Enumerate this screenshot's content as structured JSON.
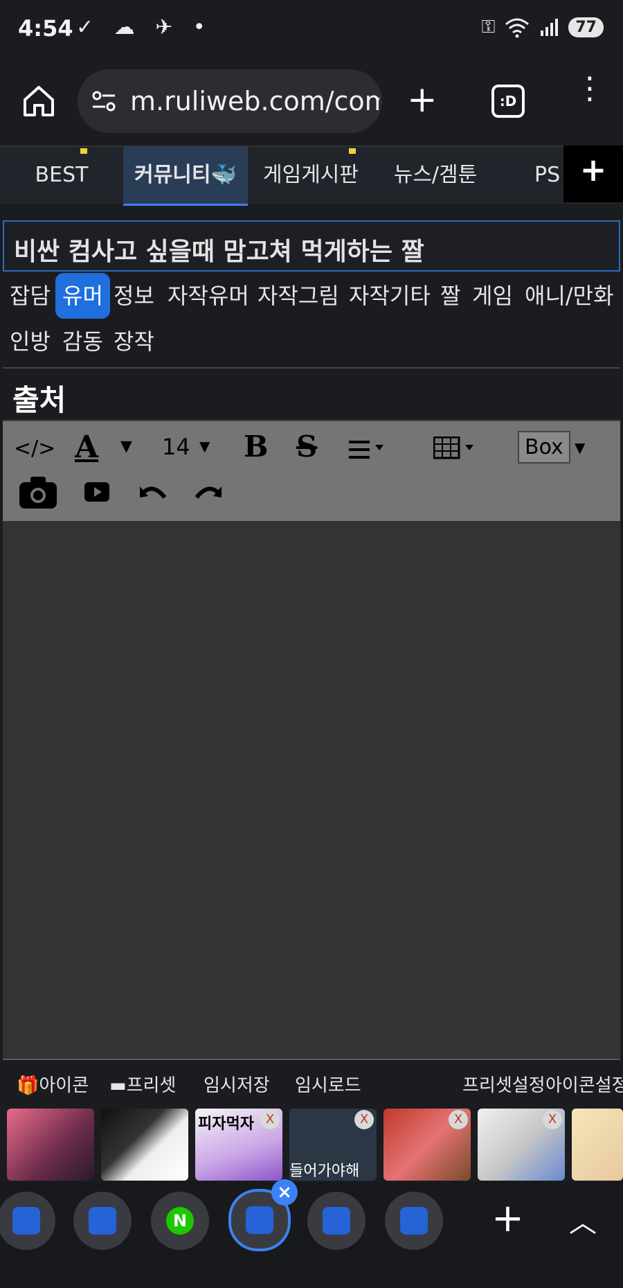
{
  "status_bar": {
    "time": "4:54",
    "battery": "77"
  },
  "browser": {
    "url": "m.ruliweb.com/comm"
  },
  "nav_tabs": [
    {
      "label": "BEST"
    },
    {
      "label": "커뮤니티🐳"
    },
    {
      "label": "게임게시판"
    },
    {
      "label": "뉴스/겜툰"
    },
    {
      "label": "PS"
    }
  ],
  "title_input": {
    "value": "비싼 컴사고 싶을때 맘고쳐 먹게하는 짤"
  },
  "categories": [
    "잡담",
    "유머",
    "정보",
    "자작유머",
    "자작그림",
    "자작기타",
    "짤",
    "게임",
    "애니/만화",
    "인방",
    "감동",
    "장작"
  ],
  "selected_category": "유머",
  "source_label": "출처",
  "toolbar": {
    "code": "</>",
    "font_size": "14",
    "box": "Box"
  },
  "bottom_tools": {
    "icon": "아이콘",
    "preset": "프리셋",
    "temp_save": "임시저장",
    "temp_load": "임시로드",
    "preset_settings": "프리셋설정",
    "icon_settings": "아이콘설정"
  },
  "thumbnails": [
    {
      "caption": ""
    },
    {
      "caption": ""
    },
    {
      "caption": "피자먹자"
    },
    {
      "caption": "들어가야해"
    },
    {
      "caption": ""
    },
    {
      "caption": ""
    },
    {
      "caption": ""
    }
  ],
  "thumb_close": "X",
  "colors": {
    "accent": "#1f6fde",
    "toolbar_bg": "#757575",
    "editor_bg": "#333333",
    "page_bg": "#1b1c20"
  }
}
